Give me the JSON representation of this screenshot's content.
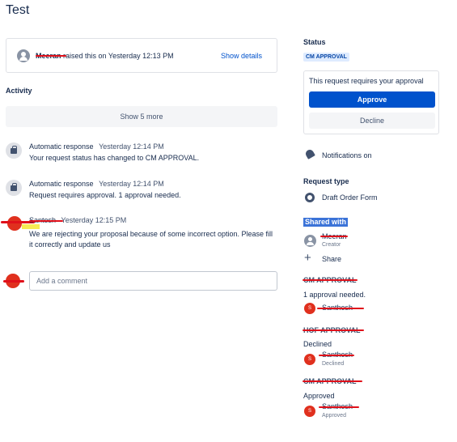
{
  "page": {
    "title": "Test"
  },
  "request": {
    "raised_by": "Meeran",
    "raised_text": "raised this on Yesterday 12:13 PM",
    "show_details": "Show details"
  },
  "activity": {
    "heading": "Activity",
    "show_more": "Show 5 more",
    "items": [
      {
        "author": "Automatic response",
        "time": "Yesterday 12:14 PM",
        "body": "Your request status has changed to CM APPROVAL."
      },
      {
        "author": "Automatic response",
        "time": "Yesterday 12:14 PM",
        "body": "Request requires approval. 1 approval needed."
      },
      {
        "author": "Santosh",
        "time": "Yesterday 12:15 PM",
        "body": "We are rejecting your proposal because of some incorrect option. Please fill it correctly and update us"
      }
    ],
    "comment_placeholder": "Add a comment"
  },
  "sidebar": {
    "status_label": "Status",
    "status_value": "CM APPROVAL",
    "approval_message": "This request requires your approval",
    "approve_label": "Approve",
    "decline_label": "Decline",
    "notifications": "Notifications on",
    "request_type_label": "Request type",
    "request_type_value": "Draft Order Form",
    "shared_with_label": "Shared with",
    "creator_name": "Meeran",
    "creator_role": "Creator",
    "share_label": "Share",
    "approvals": [
      {
        "stage": "CM APPROVAL",
        "status": "1 approval needed.",
        "approver": "Santhosh",
        "approver_status": "",
        "initial": "S"
      },
      {
        "stage": "HOF APPROVAL",
        "status": "Declined",
        "approver": "Santhosh",
        "approver_status": "Declined",
        "initial": "S"
      },
      {
        "stage": "CM APPROVAL",
        "status": "Approved",
        "approver": "Santhosh",
        "approver_status": "Approved",
        "initial": "S"
      }
    ]
  },
  "colors": {
    "accent": "#0052cc",
    "lozenge_bg": "#deebff",
    "redaction": "#e0101a",
    "shared_highlight": "#3b73d8"
  },
  "icons": [
    "user-avatar-icon",
    "shopping-bag-icon",
    "bell-icon",
    "lifebuoy-icon",
    "plus-icon"
  ]
}
